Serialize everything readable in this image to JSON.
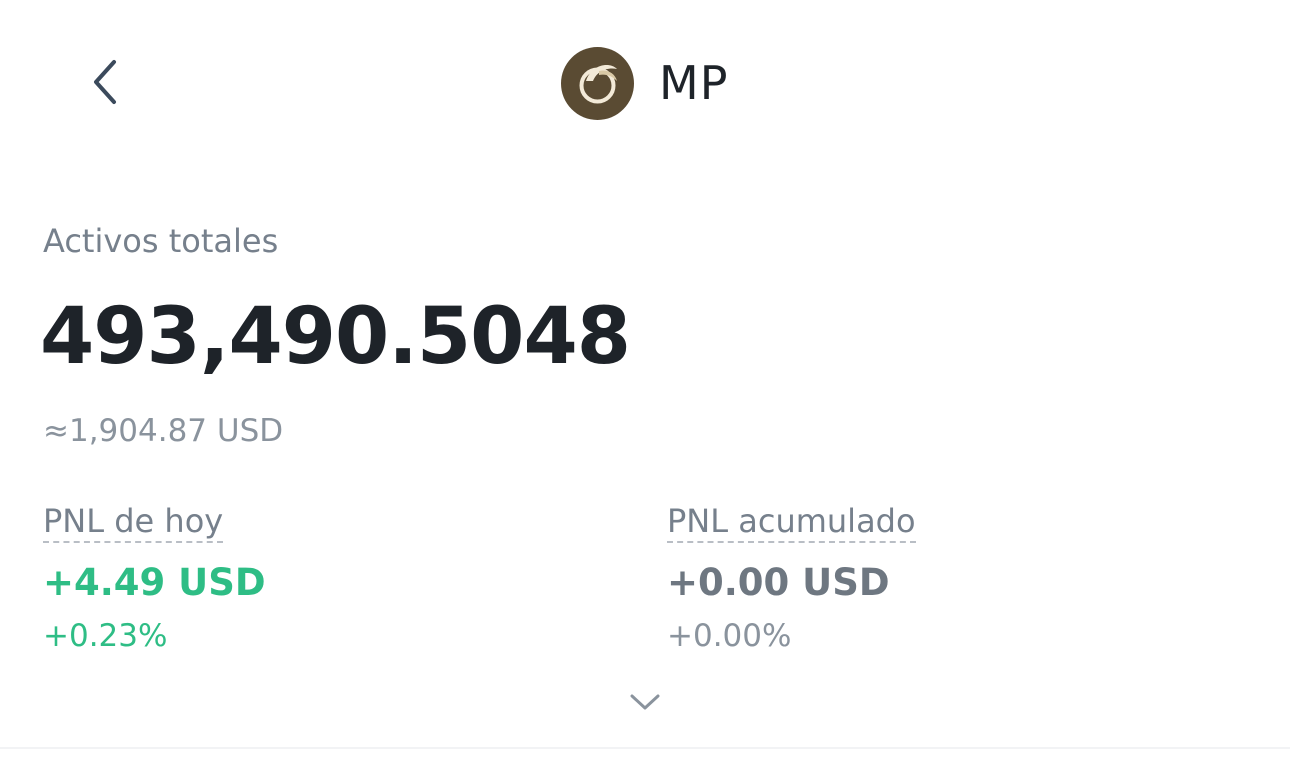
{
  "header": {
    "title": "MP",
    "back_icon": "chevron-left-icon",
    "logo_icon": "mp-coin-logo",
    "logo_color": "#5a4b33"
  },
  "totals": {
    "label": "Activos totales",
    "value": "493,490.5048",
    "approx": "≈1,904.87 USD"
  },
  "pnl_today": {
    "label": "PNL de hoy",
    "value": "+4.49 USD",
    "percent": "+0.23%",
    "color": "#2ebd85"
  },
  "pnl_cumulative": {
    "label": "PNL acumulado",
    "value": "+0.00 USD",
    "percent": "+0.00%"
  },
  "expand_icon": "chevron-down-icon"
}
